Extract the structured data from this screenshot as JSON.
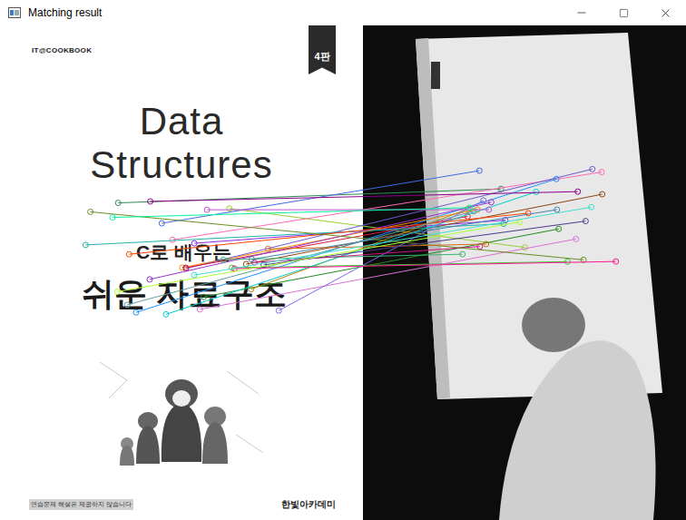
{
  "window": {
    "title": "Matching result"
  },
  "cover": {
    "series_label": "IT@COOKBOOK",
    "edition": "4판",
    "title_lines": [
      "Data",
      "Structures"
    ],
    "subtitle": "C로 배우는",
    "korean_title": "쉬운 자료구조",
    "note": "연습문제 해설은 제공하지 않습니다",
    "publisher": "한빛아카데미"
  },
  "matches": [
    {
      "color": "#2e8b57"
    },
    {
      "color": "#9acd32"
    },
    {
      "color": "#8a2be2"
    },
    {
      "color": "#ff69b4"
    },
    {
      "color": "#1e90ff"
    },
    {
      "color": "#8b4513"
    },
    {
      "color": "#32cd32"
    },
    {
      "color": "#ff8c00"
    },
    {
      "color": "#6a5acd"
    },
    {
      "color": "#dc143c"
    },
    {
      "color": "#20b2aa"
    },
    {
      "color": "#da70d6"
    },
    {
      "color": "#228b22"
    },
    {
      "color": "#4169e1"
    },
    {
      "color": "#b8860b"
    },
    {
      "color": "#9932cc"
    },
    {
      "color": "#00ced1"
    },
    {
      "color": "#ff4500"
    },
    {
      "color": "#7b68ee"
    },
    {
      "color": "#3cb371"
    },
    {
      "color": "#c71585"
    },
    {
      "color": "#4682b4"
    },
    {
      "color": "#6b8e23"
    },
    {
      "color": "#ba55d3"
    },
    {
      "color": "#d2691e"
    },
    {
      "color": "#5f9ea0"
    },
    {
      "color": "#ff1493"
    },
    {
      "color": "#00fa9a"
    },
    {
      "color": "#483d8b"
    },
    {
      "color": "#adff2f"
    },
    {
      "color": "#8b008b"
    },
    {
      "color": "#40e0d0"
    }
  ]
}
